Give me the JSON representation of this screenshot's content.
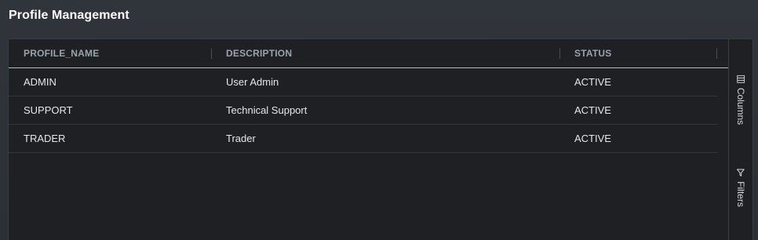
{
  "page": {
    "title": "Profile Management"
  },
  "grid": {
    "columns": [
      "PROFILE_NAME",
      "DESCRIPTION",
      "STATUS"
    ],
    "rows": [
      {
        "profile_name": "ADMIN",
        "description": "User Admin",
        "status": "ACTIVE"
      },
      {
        "profile_name": "SUPPORT",
        "description": "Technical Support",
        "status": "ACTIVE"
      },
      {
        "profile_name": "TRADER",
        "description": "Trader",
        "status": "ACTIVE"
      }
    ]
  },
  "side_panel": {
    "columns_label": "Columns",
    "filters_label": "Filters",
    "columns_icon": "columns-icon",
    "filters_icon": "filter-icon"
  },
  "colors": {
    "background": "#2c3035",
    "grid_background": "#1f2024",
    "header_text": "#9aa3ad",
    "cell_text": "#e6e7e9"
  }
}
